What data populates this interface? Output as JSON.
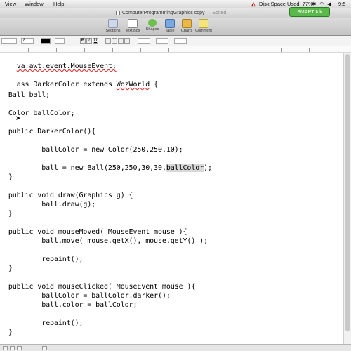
{
  "menubar": {
    "items": [
      "View",
      "Window",
      "Help"
    ],
    "status_text": "Disk Space Used: 77%",
    "time": "9:5"
  },
  "titlebar": {
    "document_title": "ComputerProgrammingGraphics copy",
    "edited_label": "— Edited"
  },
  "smart_ink": {
    "label": "SMART Ink"
  },
  "toolbar": {
    "items": [
      "Sections",
      "Text Box",
      "Shapes",
      "Table",
      "Charts",
      "Comment"
    ]
  },
  "format_bar": {
    "font_size": "8",
    "style_buttons": [
      "B",
      "I",
      "U"
    ]
  },
  "code": {
    "lines": [
      "va.awt.event.MouseEvent;",
      "",
      "ass DarkerColor extends WozWorld {",
      "",
      "  Ball ball;",
      "",
      "  Color ballColor;",
      "",
      "  public DarkerColor(){",
      "",
      "          ballColor = new Color(250,250,10);",
      "",
      "          ball = new Ball(250,250,30,30,ballColor);",
      "  }",
      "",
      "  public void draw(Graphics g) {",
      "          ball.draw(g);",
      "  }",
      "",
      "  public void mouseMoved( MouseEvent mouse ){",
      "          ball.move( mouse.getX(), mouse.getY() );",
      "",
      "          repaint();",
      "  }",
      "",
      "  public void mouseClicked( MouseEvent mouse ){",
      "          ballColor = ballColor.darker();",
      "          ball.color = ballColor;",
      "",
      "          repaint();",
      "  }"
    ]
  },
  "colors": {
    "smart_ink_green": "#5ab94a",
    "spell_error_red": "#d22222",
    "selection_gray": "#d8d8d8"
  }
}
